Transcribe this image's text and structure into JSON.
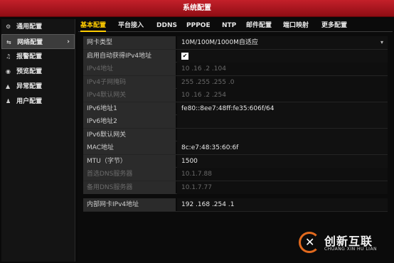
{
  "window": {
    "title": "系统配置"
  },
  "sidebar": {
    "items": [
      {
        "label": "通用配置",
        "icon": "gear-icon",
        "glyph": "⚙"
      },
      {
        "label": "网络配置",
        "icon": "network-icon",
        "glyph": "⇆",
        "active": true,
        "arrow": "›"
      },
      {
        "label": "报警配置",
        "icon": "alarm-icon",
        "glyph": "♫"
      },
      {
        "label": "预览配置",
        "icon": "eye-icon",
        "glyph": "◉"
      },
      {
        "label": "异常配置",
        "icon": "warning-icon",
        "glyph": "▲"
      },
      {
        "label": "用户配置",
        "icon": "user-icon",
        "glyph": "♟"
      }
    ]
  },
  "tabs": [
    "基本配置",
    "平台接入",
    "DDNS",
    "PPPOE",
    "NTP",
    "邮件配置",
    "端口映射",
    "更多配置"
  ],
  "form": {
    "nic_type": {
      "label": "网卡类型",
      "value": "10M/100M/1000M自适应",
      "icon": "chevron-down-icon"
    },
    "dhcp": {
      "label": "启用自动获得IPv4地址",
      "checked": "✔"
    },
    "ipv4_addr": {
      "label": "IPv4地址",
      "value": "10   .16   .2     .104"
    },
    "ipv4_mask": {
      "label": "IPv4子网掩码",
      "value": "255  .255  .255  .0"
    },
    "ipv4_gateway": {
      "label": "IPv4默认网关",
      "value": "10   .16   .2     .254"
    },
    "ipv6_addr1": {
      "label": "IPv6地址1",
      "value": "fe80::8ee7:48ff:fe35:606f/64"
    },
    "ipv6_addr2": {
      "label": "IPv6地址2",
      "value": ""
    },
    "ipv6_gateway": {
      "label": "IPv6默认网关",
      "value": ""
    },
    "mac": {
      "label": "MAC地址",
      "value": "8c:e7:48:35:60:6f"
    },
    "mtu": {
      "label": "MTU（字节）",
      "value": "1500"
    },
    "dns1": {
      "label": "首选DNS服务器",
      "value": "10.1.7.88"
    },
    "dns2": {
      "label": "备用DNS服务器",
      "value": "10.1.7.77"
    },
    "internal_ipv4": {
      "label": "内部网卡IPv4地址",
      "value": "192  .168  .254  .1"
    }
  },
  "watermark": {
    "text_cn": "创新互联",
    "text_en": "CHUANG XIN HU LIAN",
    "brand_color": "#e26a1e"
  }
}
